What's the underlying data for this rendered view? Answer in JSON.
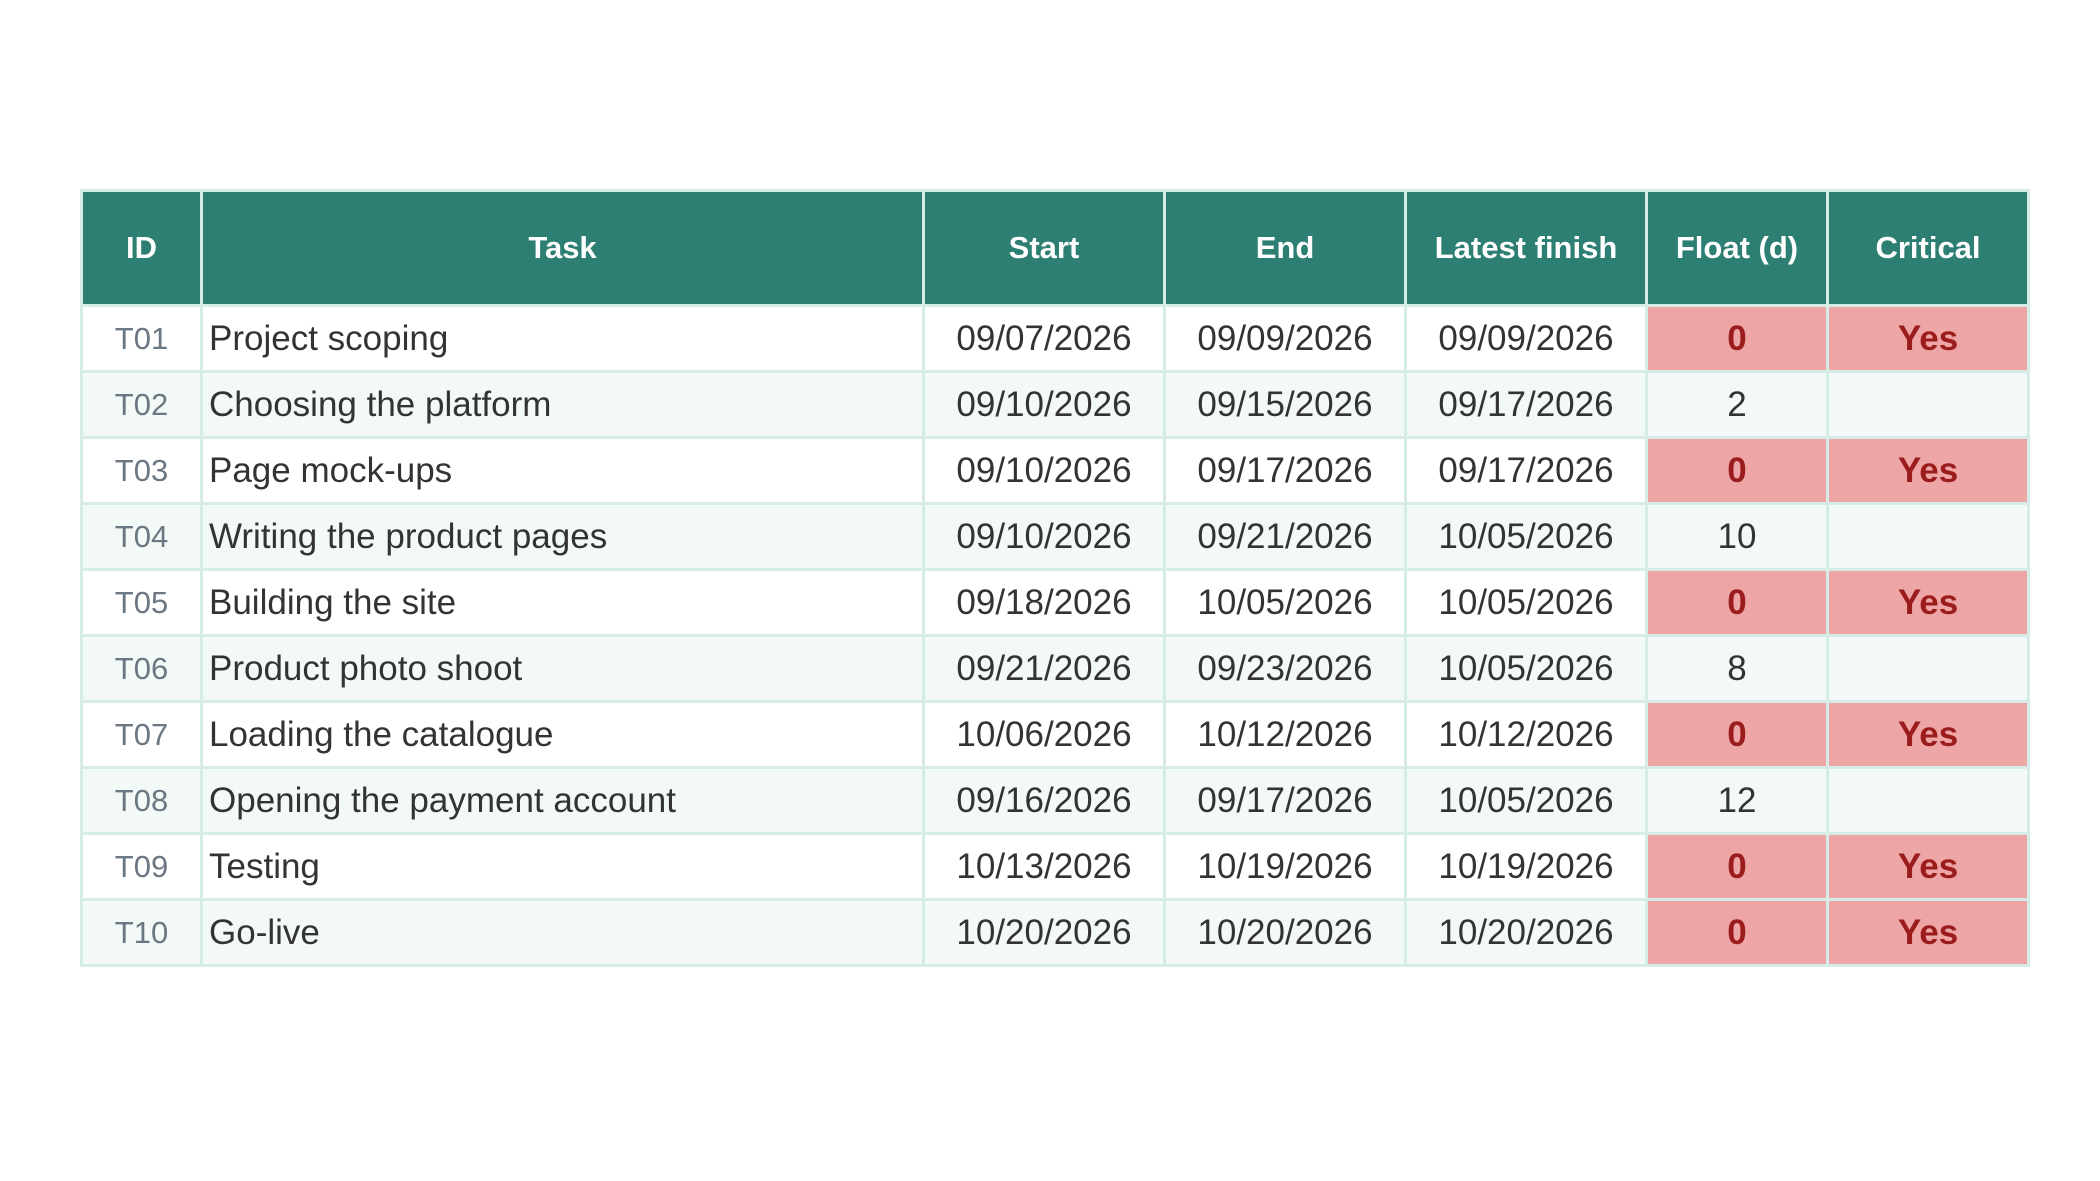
{
  "table": {
    "columns": [
      "ID",
      "Task",
      "Start",
      "End",
      "Latest finish",
      "Float (d)",
      "Critical"
    ],
    "rows": [
      {
        "id": "T01",
        "task": "Project scoping",
        "start": "09/07/2026",
        "end": "09/09/2026",
        "latest_finish": "09/09/2026",
        "float": "0",
        "critical": "Yes"
      },
      {
        "id": "T02",
        "task": "Choosing the platform",
        "start": "09/10/2026",
        "end": "09/15/2026",
        "latest_finish": "09/17/2026",
        "float": "2",
        "critical": ""
      },
      {
        "id": "T03",
        "task": "Page mock-ups",
        "start": "09/10/2026",
        "end": "09/17/2026",
        "latest_finish": "09/17/2026",
        "float": "0",
        "critical": "Yes"
      },
      {
        "id": "T04",
        "task": "Writing the product pages",
        "start": "09/10/2026",
        "end": "09/21/2026",
        "latest_finish": "10/05/2026",
        "float": "10",
        "critical": ""
      },
      {
        "id": "T05",
        "task": "Building the site",
        "start": "09/18/2026",
        "end": "10/05/2026",
        "latest_finish": "10/05/2026",
        "float": "0",
        "critical": "Yes"
      },
      {
        "id": "T06",
        "task": "Product photo shoot",
        "start": "09/21/2026",
        "end": "09/23/2026",
        "latest_finish": "10/05/2026",
        "float": "8",
        "critical": ""
      },
      {
        "id": "T07",
        "task": "Loading the catalogue",
        "start": "10/06/2026",
        "end": "10/12/2026",
        "latest_finish": "10/12/2026",
        "float": "0",
        "critical": "Yes"
      },
      {
        "id": "T08",
        "task": "Opening the payment account",
        "start": "09/16/2026",
        "end": "09/17/2026",
        "latest_finish": "10/05/2026",
        "float": "12",
        "critical": ""
      },
      {
        "id": "T09",
        "task": "Testing",
        "start": "10/13/2026",
        "end": "10/19/2026",
        "latest_finish": "10/19/2026",
        "float": "0",
        "critical": "Yes"
      },
      {
        "id": "T10",
        "task": "Go-live",
        "start": "10/20/2026",
        "end": "10/20/2026",
        "latest_finish": "10/20/2026",
        "float": "0",
        "critical": "Yes"
      }
    ]
  },
  "colors": {
    "header_background": "#2e7f73",
    "header_text": "#ffffff",
    "grid_line": "#d6ece6",
    "alt_row_background": "#f3f9f7",
    "critical_fill": "#eea5a6",
    "critical_text": "#9b1c1c"
  }
}
